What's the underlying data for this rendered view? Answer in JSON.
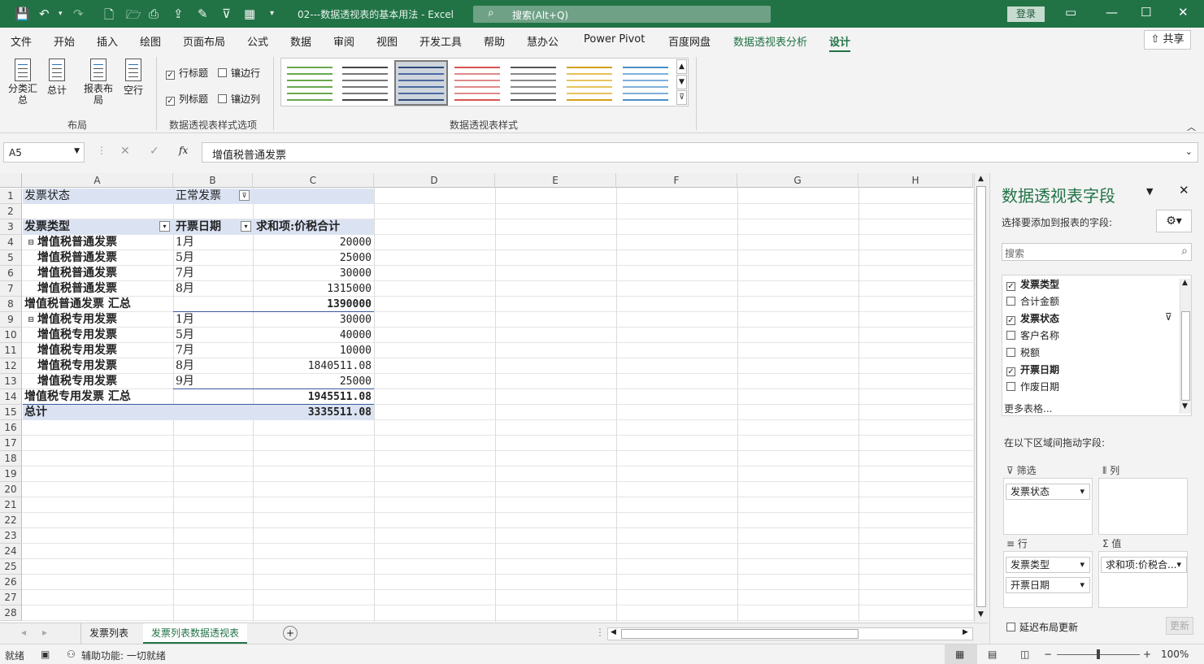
{
  "titlebar": {
    "title": "02---数据透视表的基本用法  -  Excel",
    "search_placeholder": "搜索(Alt+Q)",
    "login": "登录"
  },
  "menu": [
    "文件",
    "开始",
    "插入",
    "绘图",
    "页面布局",
    "公式",
    "数据",
    "审阅",
    "视图",
    "开发工具",
    "帮助",
    "慧办公",
    "Power Pivot",
    "百度网盘",
    "数据透视表分析",
    "设计"
  ],
  "share": "共享",
  "ribbon": {
    "layout": {
      "subtotal": "分类汇\n总",
      "grand_total": "总计",
      "report_layout": "报表布\n局",
      "blank_rows": "空行",
      "group": "布局"
    },
    "options": {
      "row_headers": "行标题",
      "col_headers": "列标题",
      "banded_rows": "镶边行",
      "banded_cols": "镶边列",
      "group": "数据透视表样式选项"
    },
    "styles": {
      "group": "数据透视表样式"
    }
  },
  "formula": {
    "name_box": "A5",
    "fx": "fx",
    "content": "增值税普通发票"
  },
  "grid": {
    "columns": [
      "A",
      "B",
      "C",
      "D",
      "E",
      "F",
      "G",
      "H"
    ],
    "rows": [
      "1",
      "2",
      "3",
      "4",
      "5",
      "6",
      "7",
      "8",
      "9",
      "10",
      "11",
      "12",
      "13",
      "14",
      "15",
      "16",
      "17",
      "18",
      "19",
      "20",
      "21",
      "22",
      "23",
      "24",
      "25",
      "26",
      "27",
      "28"
    ],
    "filter_label": "发票状态",
    "filter_value": "正常发票",
    "headers": [
      "发票类型",
      "开票日期",
      "求和项:价税合计"
    ],
    "body": [
      [
        "增值税普通发票",
        "1月",
        "20000"
      ],
      [
        "增值税普通发票",
        "5月",
        "25000"
      ],
      [
        "增值税普通发票",
        "7月",
        "30000"
      ],
      [
        "增值税普通发票",
        "8月",
        "1315000"
      ],
      [
        "增值税普通发票 汇总",
        "",
        "1390000"
      ],
      [
        "增值税专用发票",
        "1月",
        "30000"
      ],
      [
        "增值税专用发票",
        "5月",
        "40000"
      ],
      [
        "增值税专用发票",
        "7月",
        "10000"
      ],
      [
        "增值税专用发票",
        "8月",
        "1840511.08"
      ],
      [
        "增值税专用发票",
        "9月",
        "25000"
      ],
      [
        "增值税专用发票 汇总",
        "",
        "1945511.08"
      ],
      [
        "总计",
        "",
        "3335511.08"
      ]
    ]
  },
  "sheets": [
    "发票列表",
    "发票列表数据透视表"
  ],
  "status": {
    "ready": "就绪",
    "accessibility": "辅助功能: 一切就绪",
    "zoom": "100%"
  },
  "pane": {
    "title": "数据透视表字段",
    "choose_label": "选择要添加到报表的字段:",
    "search_placeholder": "搜索",
    "fields": [
      {
        "name": "发票类型",
        "checked": true
      },
      {
        "name": "合计金额",
        "checked": false
      },
      {
        "name": "发票状态",
        "checked": true
      },
      {
        "name": "客户名称",
        "checked": false
      },
      {
        "name": "税额",
        "checked": false
      },
      {
        "name": "开票日期",
        "checked": true
      },
      {
        "name": "作废日期",
        "checked": false
      }
    ],
    "more_tables": "更多表格...",
    "drag_label": "在以下区域间拖动字段:",
    "areas": {
      "filter": "筛选",
      "columns": "列",
      "rows": "行",
      "values": "值"
    },
    "filter_items": [
      "发票状态"
    ],
    "row_items": [
      "发票类型",
      "开票日期"
    ],
    "value_items": [
      "求和项:价税合..."
    ],
    "defer": "延迟布局更新",
    "update": "更新"
  }
}
